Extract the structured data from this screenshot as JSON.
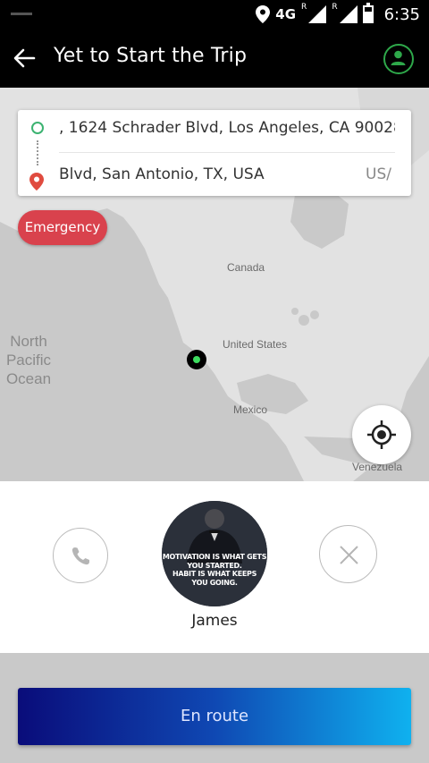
{
  "status_bar": {
    "network": "4G",
    "roaming_1": "R",
    "roaming_2": "R",
    "time": "6:35"
  },
  "toolbar": {
    "title": "Yet to Start the Trip"
  },
  "route": {
    "pickup_text": ", 1624 Schrader Blvd, Los Angeles, CA 90028,",
    "dropoff_text": "Blvd, San Antonio, TX, USA",
    "dropoff_suffix": "US/"
  },
  "emergency_label": "Emergency",
  "map": {
    "labels": {
      "canada": "Canada",
      "united_states": "United States",
      "mexico": "Mexico",
      "venezuela": "Venezuela",
      "ocean_line1": "North",
      "ocean_line2": "Pacific",
      "ocean_line3": "Ocean"
    }
  },
  "driver": {
    "name": "James",
    "avatar_quote_1": "MOTIVATION IS WHAT GETS",
    "avatar_quote_2": "YOU STARTED.",
    "avatar_quote_3": "HABIT IS WHAT KEEPS",
    "avatar_quote_4": "YOU GOING."
  },
  "primary_action": {
    "label": "En route"
  },
  "colors": {
    "accent_green": "#2ea84a",
    "emergency_red": "#d9424d",
    "button_gradient_start": "#0a0c7a",
    "button_gradient_end": "#0fb1ef"
  }
}
